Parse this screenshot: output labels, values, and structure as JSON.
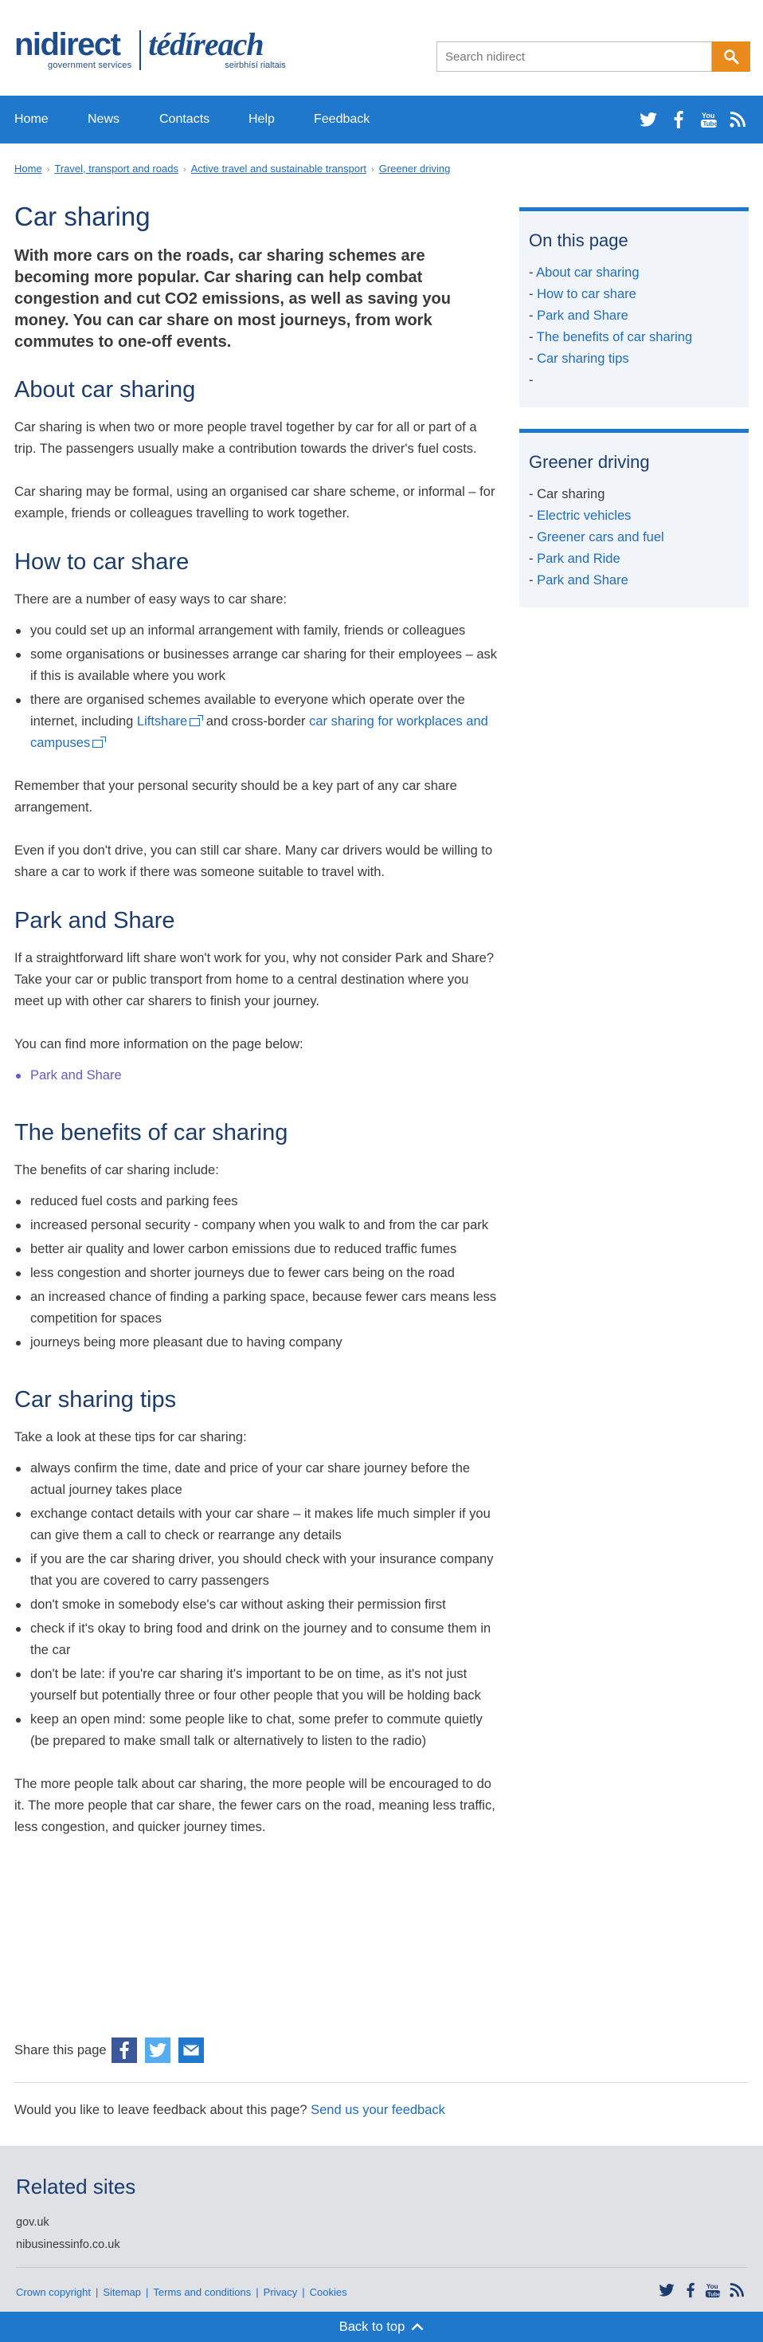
{
  "header": {
    "logo_ni": "nidirect",
    "logo_ni_sub": "government services",
    "logo_te": "tédíreach",
    "logo_te_sub": "seirbhísí rialtais",
    "search_placeholder": "Search nidirect"
  },
  "nav": {
    "items": [
      "Home",
      "News",
      "Contacts",
      "Help",
      "Feedback"
    ],
    "social": [
      "twitter-icon",
      "facebook-icon",
      "youtube-icon",
      "rss-icon"
    ]
  },
  "breadcrumb": [
    "Home",
    "Travel, transport and roads",
    "Active travel and sustainable transport",
    "Greener driving"
  ],
  "page": {
    "title": "Car sharing",
    "lead": "With more cars on the roads, car sharing schemes are becoming more popular. Car sharing can help combat congestion and cut CO2 emissions, as well as saving you money. You can car share on most journeys, from work commutes to one-off events.",
    "about": {
      "heading": "About car sharing",
      "p1": "Car sharing is when two or more people travel together by car for all or part of a trip. The passengers usually make a contribution towards the driver's fuel costs.",
      "p2": "Car sharing may be formal, using an organised car share scheme, or informal – for example, friends or colleagues travelling to work together."
    },
    "how": {
      "heading": "How to car share",
      "intro": "There are a number of easy ways to car share:",
      "li1": "you could set up an informal arrangement with family, friends or colleagues",
      "li2": "some organisations or businesses arrange car sharing for their employees – ask if this is available where you work",
      "li3_pre": "there are organised schemes available to everyone which operate over the internet, including ",
      "li3_link1": "Liftshare",
      "li3_mid": " and cross-border ",
      "li3_link2": "car sharing for workplaces and campuses",
      "p1": "Remember that your personal security should be a key part of any car share arrangement.",
      "p2": "Even if you don't drive, you can still car share. Many car drivers would be willing to share a car to work if there was someone suitable to travel with."
    },
    "park": {
      "heading": "Park and Share",
      "p1": "If a straightforward lift share won't work for you, why not consider Park and Share? Take your car or public transport from home to a central destination where you meet up with other car sharers to finish your journey.",
      "p2": "You can find more information on the page below:",
      "link": "Park and Share"
    },
    "benefits": {
      "heading": "The benefits of car sharing",
      "intro": "The benefits of car sharing include:",
      "items": [
        "reduced fuel costs and parking fees",
        "increased personal security - company when you walk to and from the car park",
        "better air quality and lower carbon emissions due to reduced traffic fumes",
        "less congestion and shorter journeys due to fewer cars being on the road",
        "an increased chance of finding a parking space, because fewer cars means less competition for spaces",
        "journeys being more pleasant due to having company"
      ]
    },
    "tips": {
      "heading": "Car sharing tips",
      "intro": "Take a look at these tips for car sharing:",
      "items": [
        "always confirm the time, date and price of your car share journey before the actual journey takes place",
        "exchange contact details with your car share – it makes life much simpler if you can give them a call to check or rearrange any details",
        "if you are the car sharing driver, you should check with your insurance company that you are covered to carry passengers",
        "don't smoke in somebody else's car without asking their permission first",
        "check if it's okay to bring food and drink on the journey and to consume them in the car",
        "don't be late: if you're car sharing it's important to be on time, as it's not just yourself but potentially three or four other people that you will be holding back",
        "keep an open mind: some people like to chat, some prefer to commute quietly (be prepared to make small talk or alternatively to listen to the radio)"
      ],
      "closing": "The more people talk about car sharing, the more people will be encouraged to do it. The more people that car share, the fewer cars on the road, meaning less traffic, less congestion, and quicker journey times."
    }
  },
  "sidebar": {
    "on_this_page": {
      "heading": "On this page",
      "items": [
        "About car sharing",
        "How to car share",
        "Park and Share",
        "The benefits of car sharing",
        "Car sharing tips"
      ]
    },
    "greener": {
      "heading": "Greener driving",
      "current": "Car sharing",
      "items": [
        "Electric vehicles",
        "Greener cars and fuel",
        "Park and Ride",
        "Park and Share"
      ]
    }
  },
  "share": {
    "label": "Share this page"
  },
  "feedback": {
    "text": "Would you like to leave feedback about this page?",
    "link": "Send us your feedback"
  },
  "footer": {
    "heading": "Related sites",
    "sites": [
      "gov.uk",
      "nibusinessinfo.co.uk"
    ],
    "links": [
      "Crown copyright",
      "Sitemap",
      "Terms and conditions",
      "Privacy",
      "Cookies"
    ]
  },
  "back_to_top": "Back to top",
  "colors": {
    "brand_blue": "#1f78cc",
    "heading_navy": "#1c3b6e",
    "search_orange": "#e98a1d",
    "link": "#1f6cc1"
  }
}
